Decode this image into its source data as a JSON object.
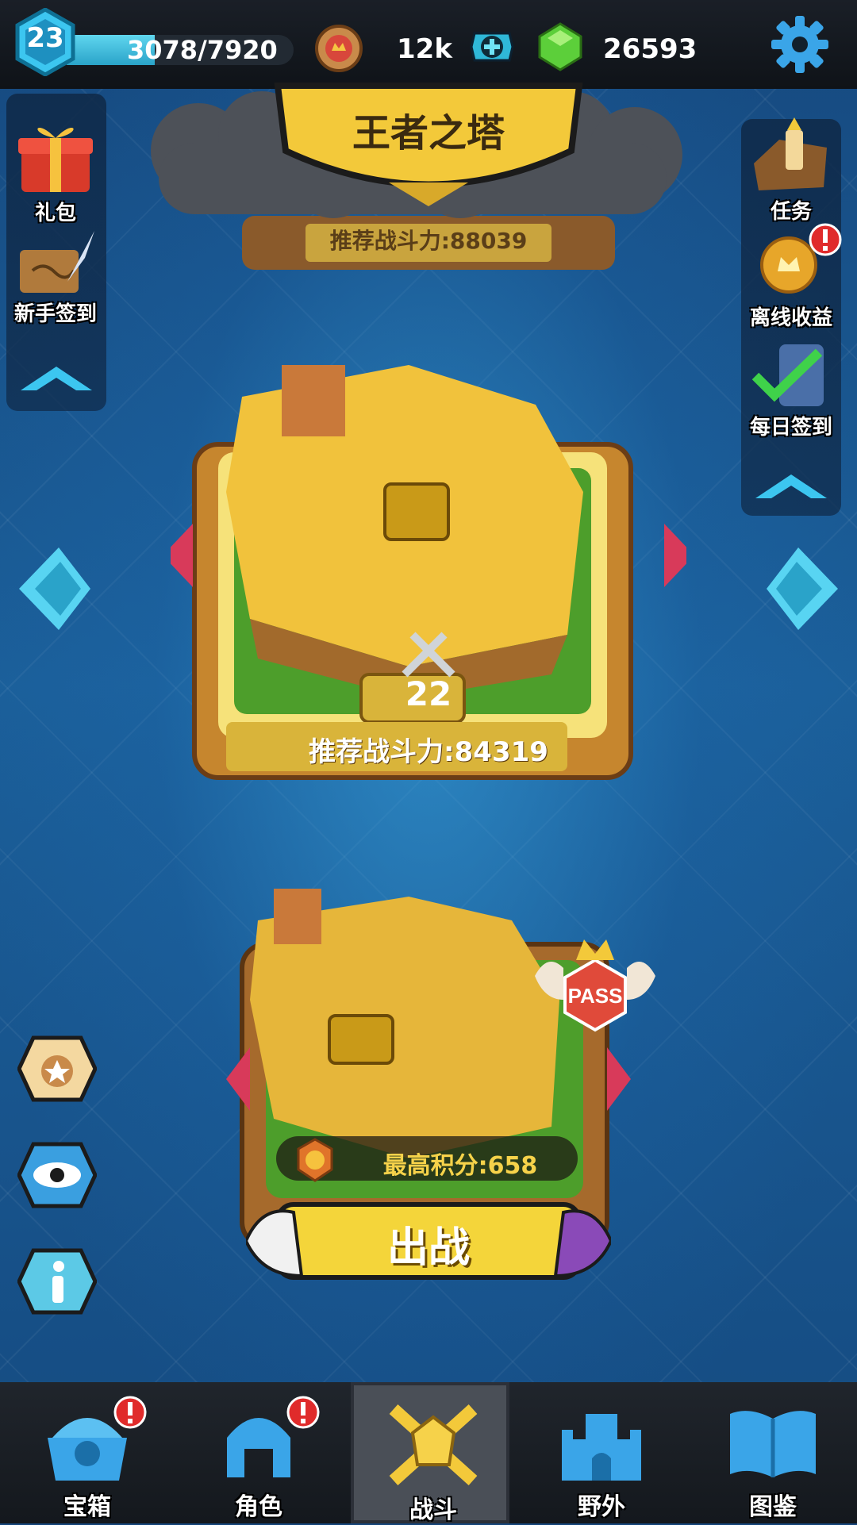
{
  "header": {
    "level": "23",
    "xp_text": "3078/7920",
    "xp_progress": 0.389,
    "coins": "12k",
    "gems": "26593"
  },
  "banner": {
    "title": "王者之塔"
  },
  "stages": {
    "top_recommended": "推荐战斗力:88039",
    "current_level": "22",
    "current_recommended": "推荐战斗力:84319",
    "next_pass_label": "PASS",
    "best_score": "最高积分:658",
    "fight_button": "出战"
  },
  "left_menu": {
    "items": [
      {
        "label": "礼包",
        "icon": "gift-box-icon"
      },
      {
        "label": "新手签到",
        "icon": "quill-scroll-icon"
      }
    ]
  },
  "right_menu": {
    "items": [
      {
        "label": "任务",
        "icon": "quest-map-icon"
      },
      {
        "label": "离线收益",
        "icon": "coin-stack-icon"
      },
      {
        "label": "每日签到",
        "icon": "checklist-icon"
      }
    ]
  },
  "bottom_nav": {
    "items": [
      {
        "label": "宝箱",
        "icon": "treasure-chest-icon",
        "alert": true
      },
      {
        "label": "角色",
        "icon": "helmet-icon",
        "alert": true
      },
      {
        "label": "战斗",
        "icon": "crossed-swords-icon",
        "active": true
      },
      {
        "label": "野外",
        "icon": "castle-icon"
      },
      {
        "label": "图鉴",
        "icon": "book-icon"
      }
    ]
  },
  "colors": {
    "accent_blue": "#3cc6f0",
    "gold": "#f3c93a",
    "alert_red": "#e02b2b",
    "bg_blue": "#1b5f9a"
  }
}
